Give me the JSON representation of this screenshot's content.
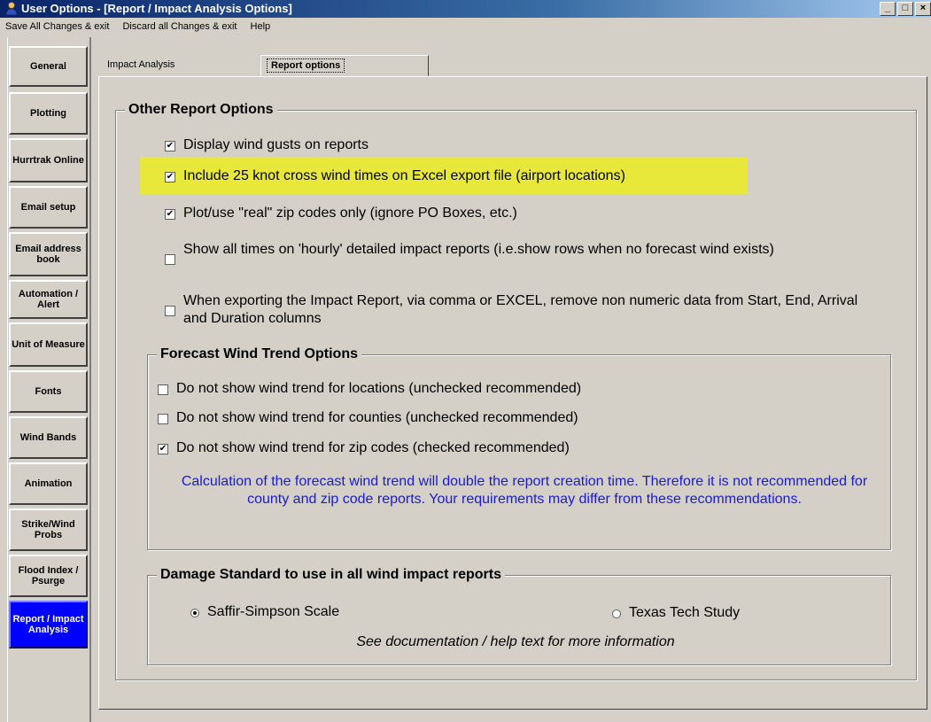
{
  "window": {
    "title": "User Options - [Report / Impact Analysis Options]",
    "controls": [
      "_",
      "□",
      "×"
    ]
  },
  "menu": [
    "Save All Changes & exit",
    "Discard all Changes & exit",
    "Help"
  ],
  "sidebar": {
    "items": [
      {
        "label": "General"
      },
      {
        "label": "Plotting"
      },
      {
        "label": "Hurrtrak Online"
      },
      {
        "label": "Email setup"
      },
      {
        "label": "Email address book"
      },
      {
        "label": "Automation / Alert"
      },
      {
        "label": "Unit of Measure"
      },
      {
        "label": "Fonts"
      },
      {
        "label": "Wind Bands"
      },
      {
        "label": "Animation"
      },
      {
        "label": "Strike/Wind Probs"
      },
      {
        "label": "Flood Index / Psurge"
      },
      {
        "label": "Report / Impact Analysis",
        "active": true
      }
    ]
  },
  "tabs": [
    {
      "label": "Impact Analysis"
    },
    {
      "label": "Report options",
      "active": true
    }
  ],
  "other_report_options": {
    "title": "Other Report Options",
    "items": [
      {
        "label": "Display wind gusts on reports",
        "checked": true
      },
      {
        "label": "Include 25 knot cross wind times on Excel export file (airport  locations)",
        "checked": true,
        "highlighted": true
      },
      {
        "label": "Plot/use \"real\" zip codes only (ignore PO Boxes, etc.)",
        "checked": true
      },
      {
        "label": "Show all times on 'hourly' detailed impact reports (i.e.show rows when no forecast wind exists)",
        "checked": false
      },
      {
        "label": "When exporting the Impact Report, via comma or EXCEL, remove non numeric data from Start, End, Arrival and Duration columns",
        "checked": false
      }
    ]
  },
  "forecast_wind_trend": {
    "title": "Forecast Wind Trend Options",
    "items": [
      {
        "label": "Do not show wind trend for locations (unchecked recommended)",
        "checked": false
      },
      {
        "label": "Do not show wind trend for counties (unchecked recommended)",
        "checked": false
      },
      {
        "label": "Do not show wind trend for zip codes (checked recommended)",
        "checked": true
      }
    ],
    "note": "Calculation of the forecast wind trend will double the report creation time.  Therefore it is not recommended for county and zip code reports.  Your requirements may differ from these recommendations."
  },
  "damage_standard": {
    "title": "Damage Standard to use in all wind impact reports",
    "options": [
      {
        "label": "Saffir-Simpson Scale",
        "selected": true
      },
      {
        "label": "Texas Tech Study",
        "selected": false
      }
    ],
    "note": "See documentation / help text for more information"
  },
  "colors": {
    "highlight": "#e8e83a",
    "note_text": "#1a1ad6",
    "active_sidebar": "#0000ff"
  }
}
